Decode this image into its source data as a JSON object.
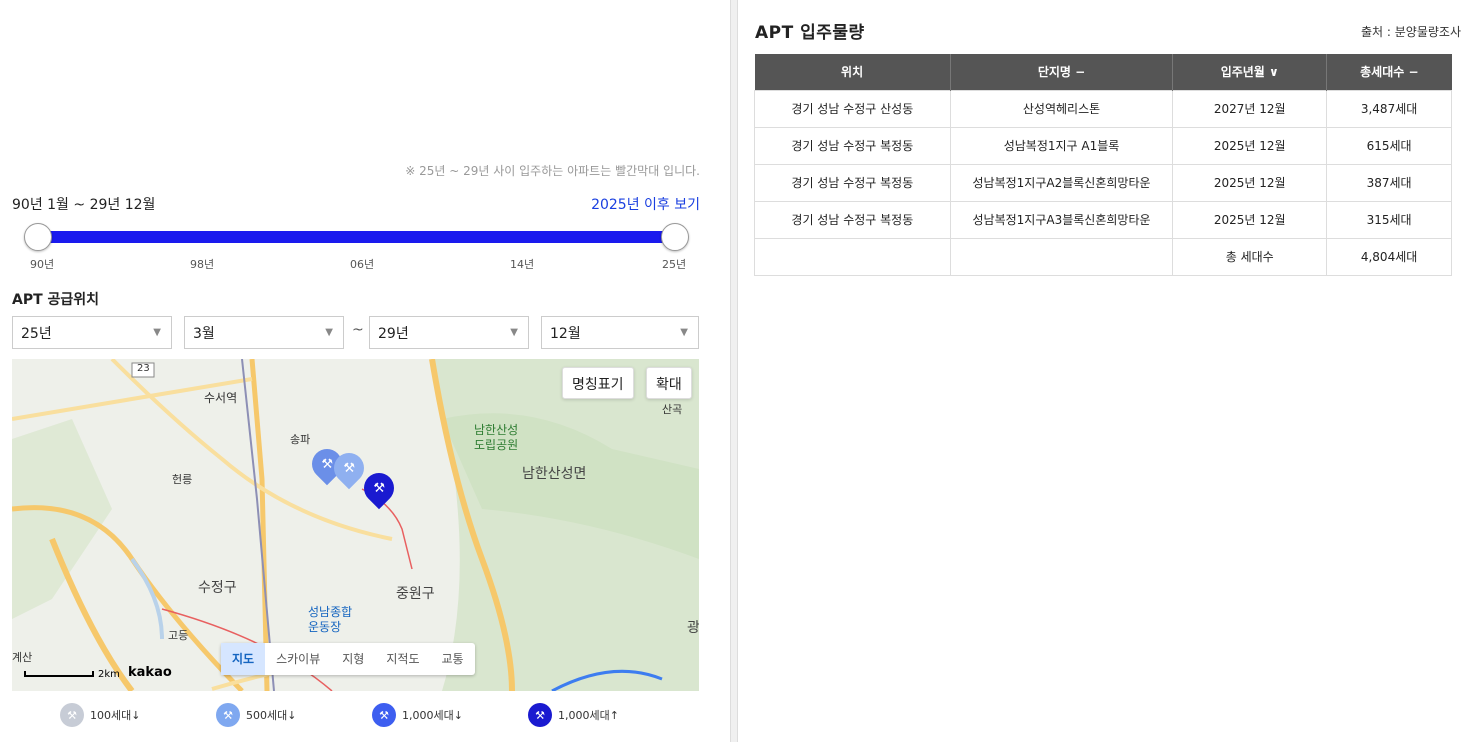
{
  "filter": {
    "note": "※ 25년 ~ 29년 사이 입주하는 아파트는 빨간막대 입니다.",
    "range_title": "90년 1월 ~ 29년 12월",
    "after_link": "2025년 이후 보기",
    "slider_ticks": [
      "90년",
      "98년",
      "06년",
      "14년",
      "25년"
    ],
    "section_title": "APT 공급위치",
    "start_year": "25년",
    "start_month": "3월",
    "tilde": "~",
    "end_year": "29년",
    "end_month": "12월",
    "arrow_icon": "▼"
  },
  "map": {
    "btn_names": "명칭표기",
    "btn_zoom": "확대",
    "labels": {
      "suseo": "수서역",
      "songpa": "송파",
      "heolleung": "헌릉",
      "namhansanseong": "남한산성\n도립공원",
      "namhansanseong_myeon": "남한산성면",
      "sujeong": "수정구",
      "jungwon": "중원구",
      "seongnam_stadium": "성남종합\n운동장",
      "godeung": "고등",
      "sangok": "산곡",
      "gyesan": "계산",
      "gwang": "광",
      "route": "23"
    },
    "map_types": [
      "지도",
      "스카이뷰",
      "지형",
      "지적도",
      "교통"
    ],
    "scale": "2km",
    "logo": "kakao"
  },
  "legend": [
    {
      "label": "100세대↓",
      "color": "#c7ccd6"
    },
    {
      "label": "500세대↓",
      "color": "#7fa8f0"
    },
    {
      "label": "1,000세대↓",
      "color": "#3d5ef0"
    },
    {
      "label": "1,000세대↑",
      "color": "#1a1ad0"
    }
  ],
  "table": {
    "title": "APT 입주물량",
    "source": "출처 : 분양물량조사",
    "headers": [
      "위치",
      "단지명 −",
      "입주년월 ∨",
      "총세대수 −"
    ],
    "rows": [
      [
        "경기 성남 수정구 산성동",
        "산성역헤리스톤",
        "2027년 12월",
        "3,487세대"
      ],
      [
        "경기 성남 수정구 복정동",
        "성남복정1지구 A1블록",
        "2025년 12월",
        "615세대"
      ],
      [
        "경기 성남 수정구 복정동",
        "성남복정1지구A2블록신혼희망타운",
        "2025년 12월",
        "387세대"
      ],
      [
        "경기 성남 수정구 복정동",
        "성남복정1지구A3블록신혼희망타운",
        "2025년 12월",
        "315세대"
      ]
    ],
    "total_label": "총 세대수",
    "total_value": "4,804세대"
  }
}
